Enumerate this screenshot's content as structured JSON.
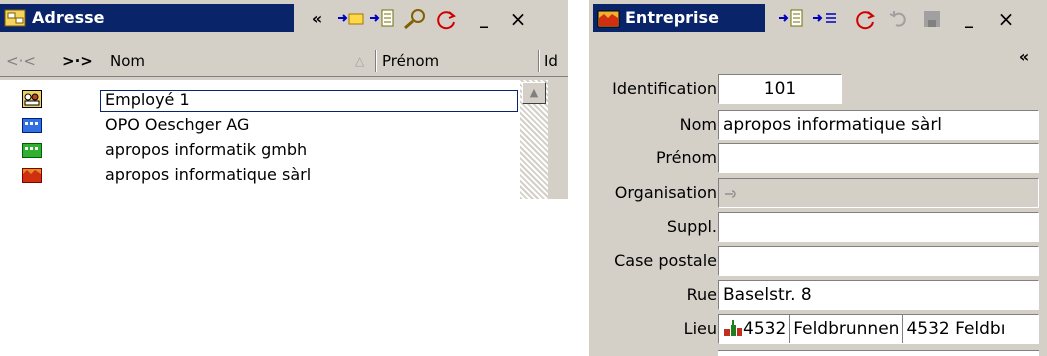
{
  "left_panel": {
    "title": "Adresse",
    "toolbar_icons": [
      "collapse-left-icon",
      "add-folder-icon",
      "add-list-icon",
      "search-icon",
      "refresh-icon",
      "minimize-icon",
      "close-icon"
    ],
    "toolbar": {
      "collapse": "«",
      "minimize": "_",
      "close": "×"
    },
    "columns": {
      "nav_back": "<·<",
      "nav_forward": ">·>",
      "name": "Nom",
      "firstname": "Prénom",
      "id": "Id"
    },
    "rows": [
      {
        "name": "Employé 1",
        "icon": "employee-icon",
        "selected": true
      },
      {
        "name": "OPO Oeschger AG",
        "icon": "company-icon-blue"
      },
      {
        "name": "apropos informatik gmbh",
        "icon": "company-icon-green"
      },
      {
        "name": "apropos informatique sàrl",
        "icon": "company-icon-red"
      }
    ]
  },
  "right_panel": {
    "title": "Entreprise",
    "toolbar": {
      "minimize": "_",
      "close": "×",
      "collapse": "«"
    },
    "toolbar_icons": [
      "add-list-icon",
      "add-item-icon",
      "refresh-icon",
      "undo-icon",
      "save-icon",
      "minimize-icon",
      "close-icon",
      "collapse-icon"
    ],
    "fields": {
      "identification": {
        "label": "Identification",
        "value": "101"
      },
      "nom": {
        "label": "Nom",
        "value": "apropos informatique sàrl"
      },
      "prenom": {
        "label": "Prénom",
        "value": ""
      },
      "organisation": {
        "label": "Organisation",
        "value": ""
      },
      "suppl": {
        "label": "Suppl.",
        "value": ""
      },
      "case_postale": {
        "label": "Case postale",
        "value": ""
      },
      "rue": {
        "label": "Rue",
        "value": "Baselstr. 8"
      },
      "lieu": {
        "label": "Lieu",
        "zip": "4532",
        "city": "Feldbrunnen",
        "combined": "4532 Feldbı"
      }
    }
  },
  "colors": {
    "title_bg": "#0a246a",
    "panel_bg": "#d4d0c8",
    "field_bg": "#ffffff"
  }
}
